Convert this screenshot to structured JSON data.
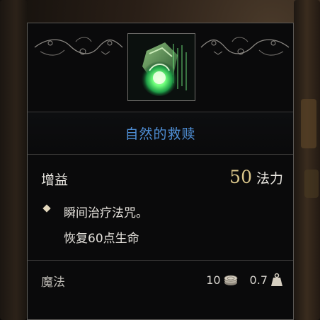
{
  "tooltip": {
    "spell_name": "自然的救赎",
    "type_label": "增益",
    "cost": {
      "value": "50",
      "unit": "法力"
    },
    "description": [
      "瞬间治疗法咒。",
      "恢复60点生命"
    ],
    "footer": {
      "school": "魔法",
      "price": "10",
      "weight": "0.7"
    },
    "icons": {
      "spell": "green-healing-orb-scroll-icon",
      "bullet": "diamond-bullet-icon",
      "price": "coin-stack-icon",
      "weight": "weight-icon"
    },
    "colors": {
      "title": "#4f8fd6",
      "cost_value": "#d9c58a",
      "text": "#e9e6e0",
      "panel": "#0a0a0b",
      "border": "#5c5a57",
      "glow": "#6dff7a"
    }
  }
}
